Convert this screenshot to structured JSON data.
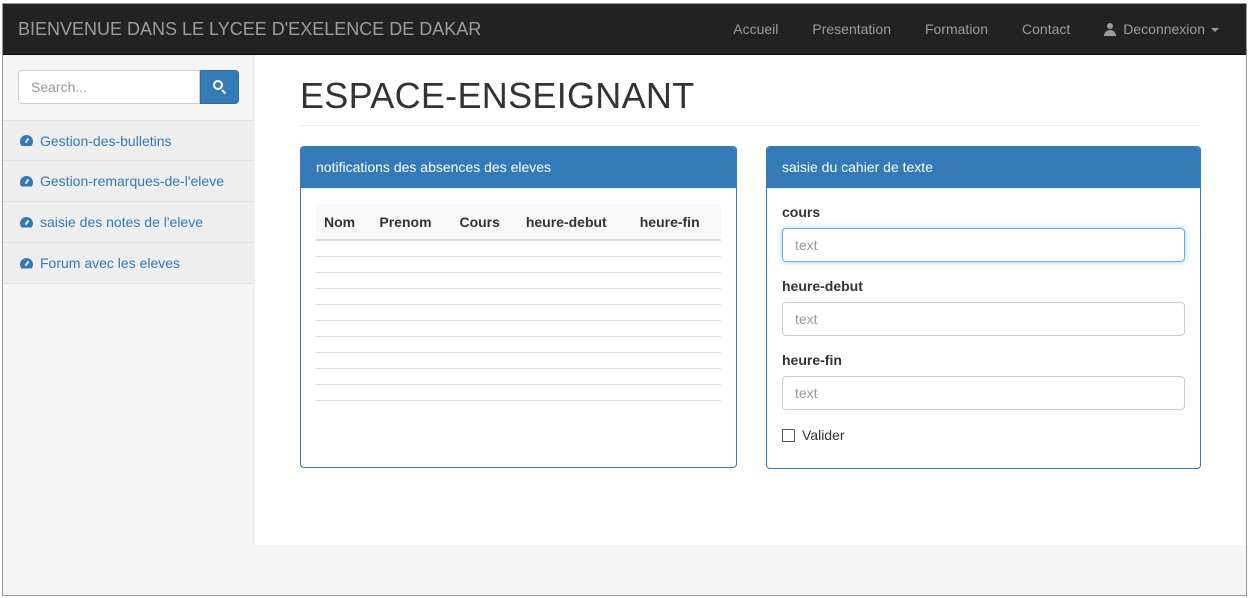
{
  "navbar": {
    "brand": "BIENVENUE DANS LE LYCEE D'EXELENCE DE DAKAR",
    "items": [
      {
        "label": "Accueil"
      },
      {
        "label": "Presentation"
      },
      {
        "label": "Formation"
      },
      {
        "label": "Contact"
      }
    ],
    "user_menu": {
      "label": "Deconnexion",
      "icon": "user-icon"
    }
  },
  "sidebar": {
    "search": {
      "placeholder": "Search...",
      "button_icon": "search-icon"
    },
    "items": [
      {
        "label": "Gestion-des-bulletins",
        "icon": "dashboard-icon"
      },
      {
        "label": "Gestion-remarques-de-l'eleve",
        "icon": "dashboard-icon"
      },
      {
        "label": "saisie des notes de l'eleve",
        "icon": "dashboard-icon"
      },
      {
        "label": "Forum avec les eleves",
        "icon": "dashboard-icon"
      }
    ]
  },
  "main": {
    "title": "ESPACE-ENSEIGNANT",
    "absences_panel": {
      "heading": "notifications des absences des eleves",
      "columns": [
        "Nom",
        "Prenom",
        "Cours",
        "heure-debut",
        "heure-fin"
      ]
    },
    "cahier_panel": {
      "heading": "saisie du cahier de texte",
      "fields": [
        {
          "label": "cours",
          "placeholder": "text"
        },
        {
          "label": "heure-debut",
          "placeholder": "text"
        },
        {
          "label": "heure-fin",
          "placeholder": "text"
        }
      ],
      "checkbox_label": "Valider"
    }
  },
  "colors": {
    "primary": "#337ab7",
    "navbar": "#222222",
    "link": "#337ab7"
  }
}
